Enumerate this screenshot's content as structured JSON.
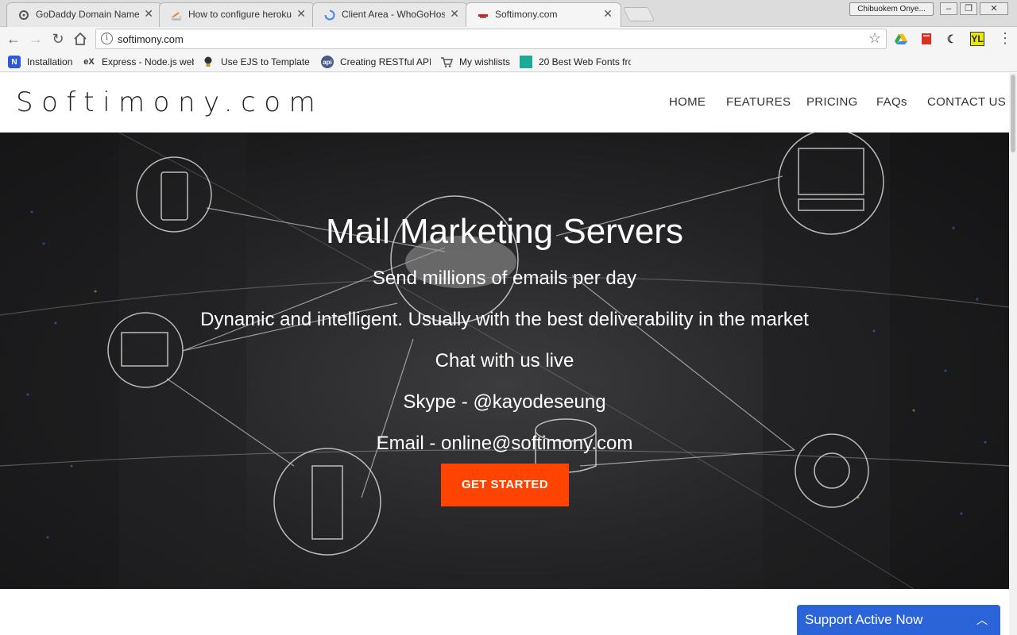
{
  "browser": {
    "tabs": [
      {
        "title": "GoDaddy Domain Name",
        "icon": "godaddy-icon"
      },
      {
        "title": "How to configure heroku",
        "icon": "stackoverflow-icon"
      },
      {
        "title": "Client Area - WhoGoHost",
        "icon": "loading-icon"
      },
      {
        "title": "Softimony.com",
        "icon": "softimony-icon"
      }
    ],
    "profile_name": "Chibuokem Onye...",
    "url": "softimony.com",
    "bookmarks": [
      {
        "label": "Installation",
        "icon": "N"
      },
      {
        "label": "Express - Node.js web",
        "icon": "ex"
      },
      {
        "label": "Use EJS to Template Y",
        "icon": "bulb"
      },
      {
        "label": "Creating RESTful APIs",
        "icon": "api"
      },
      {
        "label": "My wishlists",
        "icon": "cart"
      },
      {
        "label": "20 Best Web Fonts fro",
        "icon": "square"
      }
    ]
  },
  "site": {
    "logo": "Softimony.com",
    "nav": [
      "HOME",
      "FEATURES",
      "PRICING",
      "FAQs",
      "CONTACT US"
    ],
    "hero": {
      "title": "Mail Marketing Servers",
      "lines": [
        "Send millions of emails per day",
        "Dynamic and intelligent. Usually with the best deliverability in the market",
        "Chat with us live",
        "Skype - @kayodeseung",
        "Email - online@softimony.com"
      ],
      "cta": "GET STARTED"
    },
    "support_widget": "Support Active Now"
  },
  "colors": {
    "cta": "#ff4300",
    "support": "#2a64d8"
  }
}
